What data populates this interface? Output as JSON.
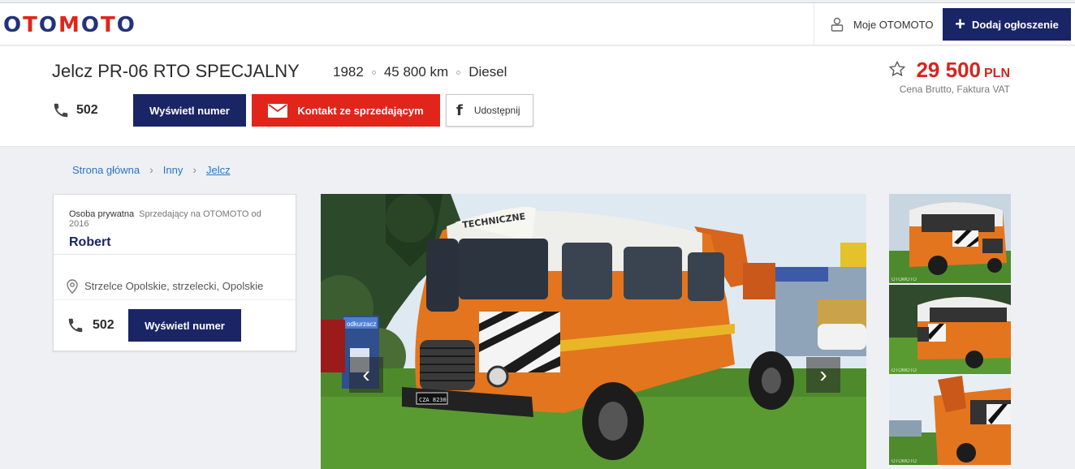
{
  "header": {
    "logo": "OTOMOTO",
    "account_label": "Moje OTOMOTO",
    "add_listing_label": "Dodaj ogłoszenie"
  },
  "listing": {
    "title": "Jelcz PR-06 RTO SPECJALNY",
    "year": "1982",
    "mileage": "45 800 km",
    "fuel": "Diesel",
    "phone_prefix": "502",
    "show_number_label": "Wyświetl numer",
    "contact_label": "Kontakt ze sprzedającym",
    "share_label": "Udostępnij",
    "price": "29 500",
    "currency": "PLN",
    "price_note": "Cena Brutto, Faktura VAT"
  },
  "breadcrumb": [
    "Strona główna",
    "Inny",
    "Jelcz"
  ],
  "seller": {
    "type": "Osoba prywatna",
    "since": "Sprzedający na OTOMOTO od 2016",
    "name": "Robert",
    "location": "Strzelce Opolskie, strzelecki, Opolskie",
    "phone_prefix": "502",
    "show_number_label": "Wyświetl numer"
  },
  "gallery": {
    "plate": "CZA 8230",
    "truck_text": "TECHNICZNE",
    "sign_text": "odkurzacz",
    "thumb_watermark": "OTOMOTO",
    "prev_icon": "chevron-left-icon",
    "next_icon": "chevron-right-icon"
  },
  "colors": {
    "brand_red": "#e1251b",
    "brand_navy": "#1a2566",
    "link_blue": "#2b73c8"
  }
}
